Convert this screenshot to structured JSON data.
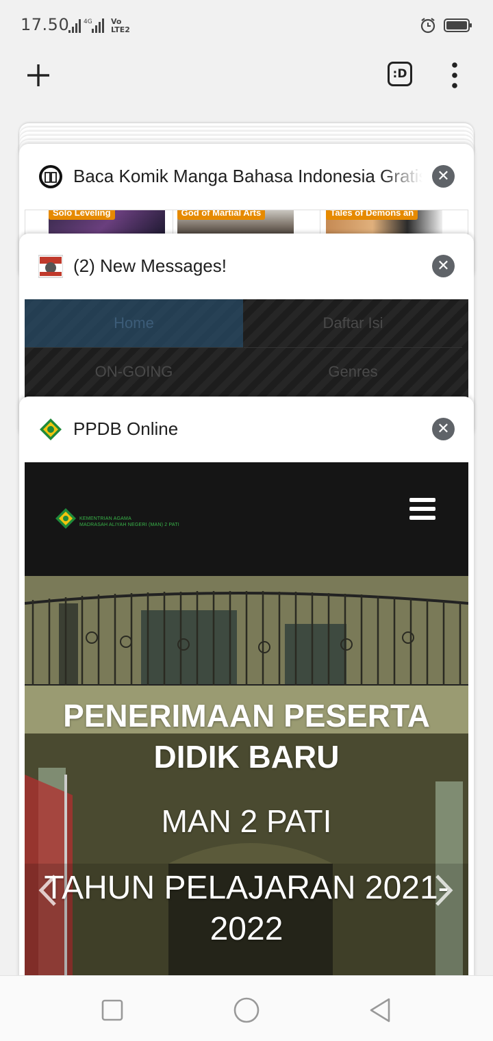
{
  "status": {
    "time": "17.50",
    "network_4g": "4G",
    "volte_top": "Vo",
    "volte_bottom": "LTE2"
  },
  "toolbar": {
    "new_tab": "+",
    "tab_switcher_label": ":D"
  },
  "tabs": [
    {
      "title": "Baca Komik Manga Bahasa Indonesia Gratis",
      "thumbs": [
        "Solo Leveling",
        "God of Martial Arts",
        "Tales of Demons an"
      ]
    },
    {
      "title": "(2) New Messages!",
      "menu": [
        "Home",
        "Daftar Isi",
        "ON-GOING",
        "Genres"
      ]
    },
    {
      "title": "PPDB Online",
      "logo_line1": "KEMENTRIAN AGAMA",
      "logo_line2": "MADRASAH ALIYAH NEGERI (MAN) 2 PATI",
      "headline": "PENERIMAAN PESERTA DIDIK BARU",
      "school": "MAN 2 PATI",
      "year": "TAHUN PELAJARAN 2021-2022"
    }
  ],
  "colors": {
    "close_button": "#5f6368",
    "label_orange": "#e68a00",
    "logo_green": "#39b54a"
  }
}
